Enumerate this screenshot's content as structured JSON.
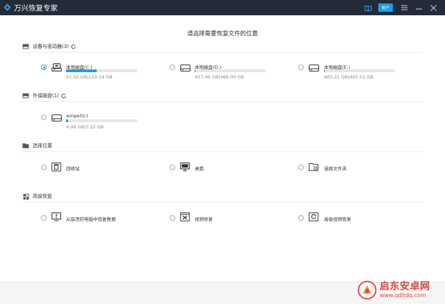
{
  "app": {
    "title": "万兴恢复专家",
    "account_label": "帐户"
  },
  "main": {
    "title": "请选择需要恢复文件的位置"
  },
  "sections": {
    "devices": {
      "title": "设备与驱动器(3)"
    },
    "external": {
      "title": "外接磁盘(1)"
    },
    "location": {
      "title": "选择位置"
    },
    "advanced": {
      "title": "高级恢复"
    }
  },
  "drives": [
    {
      "name": "本地磁盘(C:)",
      "size": "51.55 GB|119.24 GB",
      "used_fraction": 0.43,
      "selected": true
    },
    {
      "name": "本地磁盘(D:)",
      "size": "457.40 GB|466.00 GB",
      "used_fraction": 0.01,
      "selected": false
    },
    {
      "name": "本地磁盘(E:)",
      "size": "465.21 GB|465.51 GB",
      "used_fraction": 0.01,
      "selected": false
    }
  ],
  "external_drives": [
    {
      "name": "winpe(G:)",
      "size": "6.98 GB|7.22 GB",
      "used_fraction": 0.03,
      "selected": false
    }
  ],
  "locations": [
    {
      "label": "回收站",
      "icon": "recycle-bin-icon"
    },
    {
      "label": "桌面",
      "icon": "desktop-icon"
    },
    {
      "label": "选择文件夹",
      "icon": "folder-icon"
    }
  ],
  "advanced": [
    {
      "label": "从崩溃的电脑中恢复数据",
      "icon": "crash-computer-icon"
    },
    {
      "label": "视频修复",
      "icon": "video-repair-icon"
    },
    {
      "label": "高级视频恢复",
      "icon": "advanced-video-icon"
    }
  ],
  "watermark": {
    "name": "启东安卓网",
    "url": "www.qdltdq.com"
  },
  "colors": {
    "titlebar": "#232a38",
    "accent": "#1e9fe4",
    "watermark": "#d9453a"
  }
}
